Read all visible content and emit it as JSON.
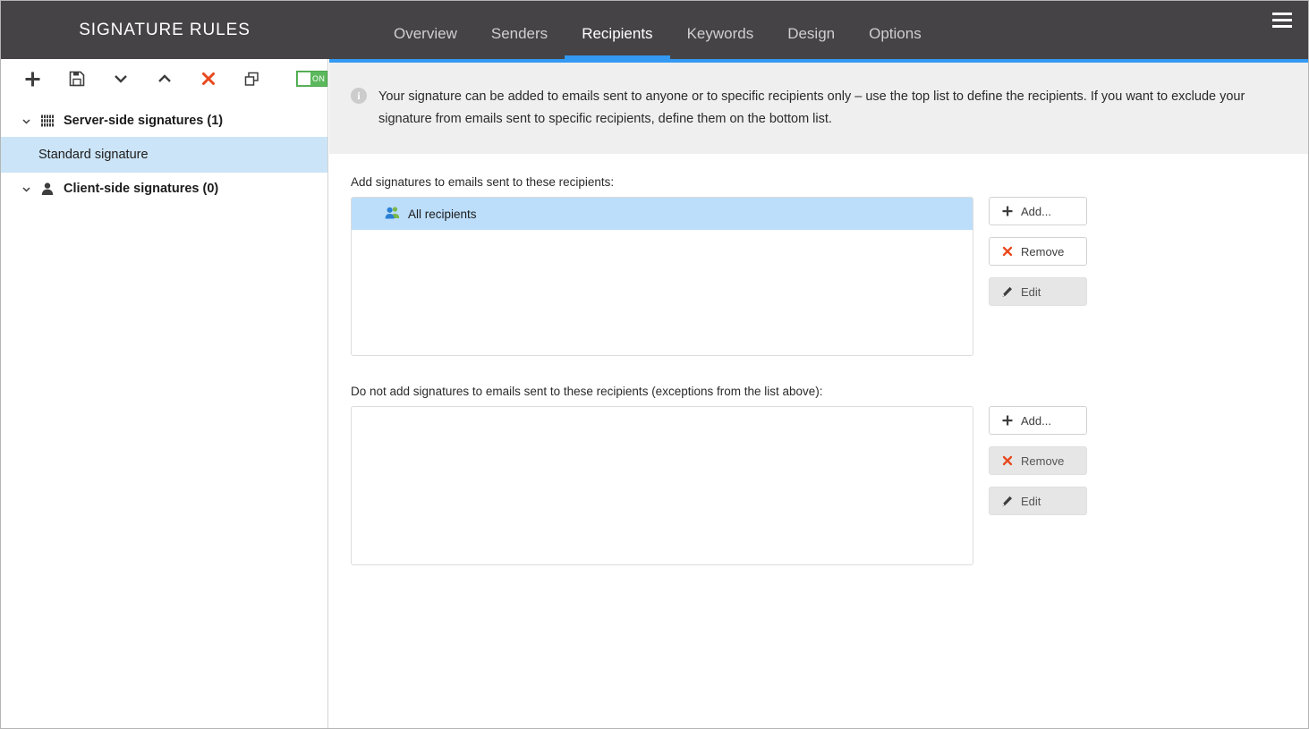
{
  "app": {
    "brand_title": "SIGNATURE RULES"
  },
  "header": {
    "menu_icon": "hamburger-icon",
    "tabs": [
      {
        "label": "Overview",
        "active": false
      },
      {
        "label": "Senders",
        "active": false
      },
      {
        "label": "Recipients",
        "active": true
      },
      {
        "label": "Keywords",
        "active": false
      },
      {
        "label": "Design",
        "active": false
      },
      {
        "label": "Options",
        "active": false
      }
    ],
    "accent_color": "#3399f3",
    "bar_color": "#454345"
  },
  "sidebar": {
    "toolbar": [
      {
        "name": "add-icon",
        "glyph": "+"
      },
      {
        "name": "save-icon",
        "glyph": "save"
      },
      {
        "name": "chevron-down-icon",
        "glyph": "v"
      },
      {
        "name": "chevron-up-icon",
        "glyph": "^"
      },
      {
        "name": "delete-icon",
        "glyph": "x"
      },
      {
        "name": "duplicate-icon",
        "glyph": "copy"
      }
    ],
    "toggle": {
      "label": "ON",
      "state": "on",
      "color": "#5cb85c"
    },
    "tree": [
      {
        "label": "Server-side signatures (1)",
        "icon": "server-icon",
        "expanded": true,
        "children": [
          {
            "label": "Standard signature",
            "selected": true
          }
        ]
      },
      {
        "label": "Client-side signatures (0)",
        "icon": "user-icon",
        "expanded": true,
        "children": []
      }
    ]
  },
  "main": {
    "info_banner": {
      "icon": "info-icon",
      "text": "Your signature can be added to emails sent to anyone or to specific recipients only – use the top list to define the recipients. If you want to exclude your signature from emails sent to specific recipients, define them on the bottom list."
    },
    "include_section": {
      "label": "Add signatures to emails sent to these recipients:",
      "items": [
        {
          "label": "All recipients",
          "icon": "people-icon",
          "selected": true
        }
      ],
      "buttons": [
        {
          "label": "Add...",
          "icon": "plus-icon",
          "state": "enabled"
        },
        {
          "label": "Remove",
          "icon": "x-icon",
          "state": "enabled"
        },
        {
          "label": "Edit",
          "icon": "pencil-icon",
          "state": "dim"
        }
      ]
    },
    "exclude_section": {
      "label": "Do not add signatures to emails sent to these recipients (exceptions from the list above):",
      "items": [],
      "buttons": [
        {
          "label": "Add...",
          "icon": "plus-icon",
          "state": "enabled"
        },
        {
          "label": "Remove",
          "icon": "x-icon",
          "state": "dim"
        },
        {
          "label": "Edit",
          "icon": "pencil-icon",
          "state": "dim"
        }
      ]
    }
  }
}
